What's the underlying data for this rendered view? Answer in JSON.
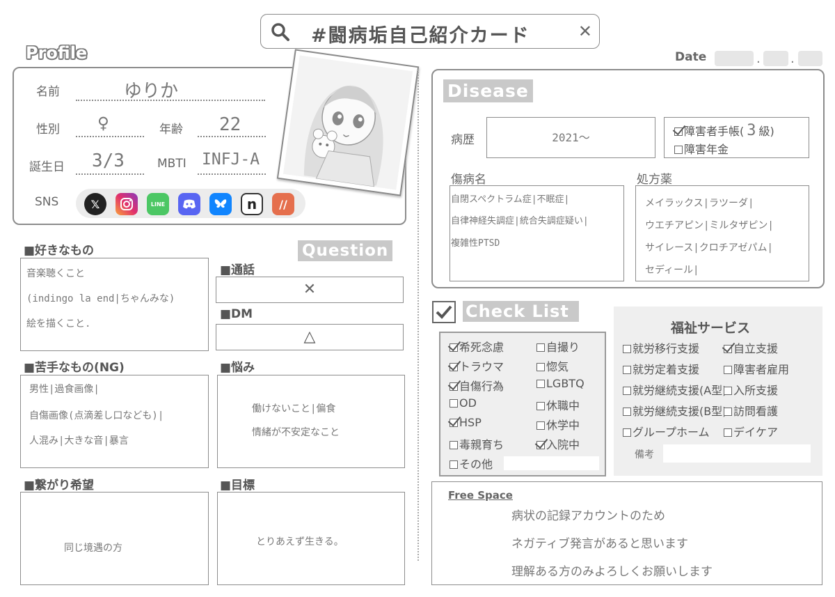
{
  "search": {
    "title": "#闘病垢自己紹介カード",
    "close": "✕"
  },
  "profile_heading": "Profile",
  "date": {
    "label": "Date",
    "sep1": ".",
    "sep2": "."
  },
  "profile": {
    "name_label": "名前",
    "name_value": "ゆりか",
    "gender_label": "性別",
    "gender_value": "♀",
    "age_label": "年齢",
    "age_value": "22",
    "birthday_label": "誕生日",
    "birthday_value": "3/3",
    "mbti_label": "MBTI",
    "mbti_value": "INFJ-A",
    "sns_label": "SNS",
    "sns_icons": [
      "x-icon",
      "instagram-icon",
      "line-icon",
      "discord-icon",
      "bluesky-icon",
      "note-icon",
      "misskey-icon"
    ]
  },
  "question_heading": "Question",
  "likes": {
    "title": "■好きなもの",
    "lines": [
      "音楽聴くこと",
      "(indingo la end|ちゃんみな)",
      "絵を描くこと."
    ]
  },
  "call": {
    "title": "■通話",
    "value": "✕"
  },
  "dm": {
    "title": "■DM",
    "value": "△"
  },
  "dislikes": {
    "title": "■苦手なもの(NG)",
    "lines": [
      "男性|過食画像|",
      "自傷画像(点滴差し口なども)|",
      "人混み|大きな音|暴言"
    ]
  },
  "worries": {
    "title": "■悩み",
    "lines": [
      "働けないこと|偏食",
      "情緒が不安定なこと"
    ]
  },
  "connection": {
    "title": "■繋がり希望",
    "value": "同じ境遇の方"
  },
  "goal": {
    "title": "■目標",
    "value": "とりあえず生きる。"
  },
  "disease": {
    "heading": "Disease",
    "history_label": "病歴",
    "history_value": "2021〜",
    "handbook_label": "障害者手帳(",
    "handbook_grade": "3",
    "handbook_suffix": "級)",
    "pension_label": "障害年金",
    "diagnosis_label": "傷病名",
    "diagnosis_lines": [
      "自閉スペクトラム症|不眠症|",
      "自律神経失調症|統合失調症疑い|",
      "複雑性PTSD"
    ],
    "medicine_label": "処方薬",
    "medicine_lines": [
      "メイラックス|ラツーダ|",
      "ウエチアピン|ミルタザピン|",
      "サイレース|クロチアゼパム|",
      "セディール|"
    ]
  },
  "checklist": {
    "heading": "Check List",
    "left": [
      {
        "label": "希死念慮",
        "checked": true
      },
      {
        "label": "トラウマ",
        "checked": true
      },
      {
        "label": "自傷行為",
        "checked": true
      },
      {
        "label": "OD",
        "checked": false
      },
      {
        "label": "HSP",
        "checked": true
      },
      {
        "label": "毒親育ち",
        "checked": false
      },
      {
        "label": "その他",
        "checked": false
      }
    ],
    "right": [
      {
        "label": "自撮り",
        "checked": false
      },
      {
        "label": "惚気",
        "checked": false
      },
      {
        "label": "LGBTQ",
        "checked": false
      },
      {
        "label": "休職中",
        "checked": false
      },
      {
        "label": "休学中",
        "checked": false
      },
      {
        "label": "入院中",
        "checked": true
      }
    ]
  },
  "welfare": {
    "title": "福祉サービス",
    "left": [
      {
        "label": "就労移行支援",
        "checked": false
      },
      {
        "label": "就労定着支援",
        "checked": false
      },
      {
        "label": "就労継続支援(A型)",
        "checked": false
      },
      {
        "label": "就労継続支援(B型)",
        "checked": false
      },
      {
        "label": "グループホーム",
        "checked": false
      }
    ],
    "right": [
      {
        "label": "自立支援",
        "checked": true
      },
      {
        "label": "障害者雇用",
        "checked": false
      },
      {
        "label": "入所支援",
        "checked": false
      },
      {
        "label": "訪問看護",
        "checked": false
      },
      {
        "label": "デイケア",
        "checked": false
      }
    ],
    "note_label": "備考"
  },
  "free_space": {
    "heading": "Free Space",
    "lines": [
      "病状の記録アカウントのため",
      "ネガティブ発言があると思います",
      "理解ある方のみよろしくお願いします"
    ]
  },
  "colors": {
    "border": "#8c8c8c",
    "tag_bg": "#c9c9c9",
    "text": "#555555"
  }
}
